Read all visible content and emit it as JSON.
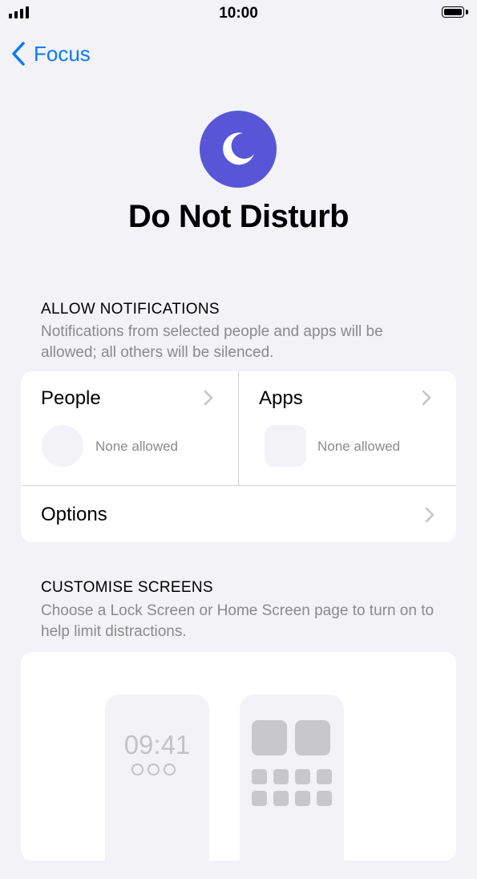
{
  "status_bar": {
    "time": "10:00"
  },
  "nav": {
    "back_label": "Focus"
  },
  "header": {
    "title": "Do Not Disturb",
    "icon": "moon-icon",
    "icon_color": "#5856d6"
  },
  "allow_notifications": {
    "header": "ALLOW NOTIFICATIONS",
    "footer": "Notifications from selected people and apps will be allowed; all others will be silenced.",
    "people": {
      "label": "People",
      "status": "None allowed"
    },
    "apps": {
      "label": "Apps",
      "status": "None allowed"
    },
    "options": {
      "label": "Options"
    }
  },
  "customise_screens": {
    "header": "CUSTOMISE SCREENS",
    "footer": "Choose a Lock Screen or Home Screen page to turn on to help limit distractions.",
    "lock_screen_time": "09:41"
  },
  "colors": {
    "accent": "#0a7aff",
    "background": "#f2f2f7"
  }
}
